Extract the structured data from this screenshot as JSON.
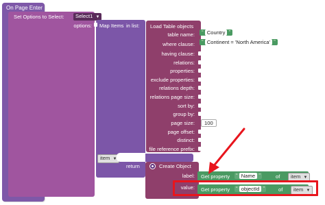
{
  "event": {
    "title": "On Page Enter"
  },
  "set_options": {
    "label": "Set Options to Select:",
    "component": "Select1",
    "options_label": "options:"
  },
  "map_items": {
    "label": "Map Items",
    "in_list_label": "in list:",
    "item_var": "item",
    "return_label": "return"
  },
  "load_table": {
    "title": "Load Table objects",
    "rows": [
      {
        "label": "table name:",
        "value": "Country"
      },
      {
        "label": "where clause:",
        "value": "Continent = 'North America'"
      },
      {
        "label": "having clause:",
        "value": ""
      },
      {
        "label": "relations:",
        "value": ""
      },
      {
        "label": "properties:",
        "value": ""
      },
      {
        "label": "exclude properties:",
        "value": ""
      },
      {
        "label": "relations depth:",
        "value": ""
      },
      {
        "label": "relations page size:",
        "value": ""
      },
      {
        "label": "sort by:",
        "value": ""
      },
      {
        "label": "group by:",
        "value": ""
      },
      {
        "label": "page size:",
        "value": "100"
      },
      {
        "label": "page offset:",
        "value": ""
      },
      {
        "label": "distinct:",
        "value": ""
      },
      {
        "label": "file reference prefix:",
        "value": ""
      }
    ]
  },
  "create_object": {
    "title": "Create Object",
    "label_row": {
      "label": "label:",
      "get": "Get property",
      "prop": "Name",
      "of": "of",
      "var": "item"
    },
    "value_row": {
      "label": "value:",
      "get": "Get property",
      "prop": "objectId",
      "of": "of",
      "var": "item"
    }
  },
  "colors": {
    "event": "#7e58a8",
    "set_options": "#a0559f",
    "map_items": "#7c56a8",
    "load_table": "#8f3f6b",
    "text_string": "#4a9a62",
    "number": "#ffffff",
    "create_object": "#8f3f6b",
    "get_property": "#4a9a62",
    "highlight": "#e8151d"
  }
}
